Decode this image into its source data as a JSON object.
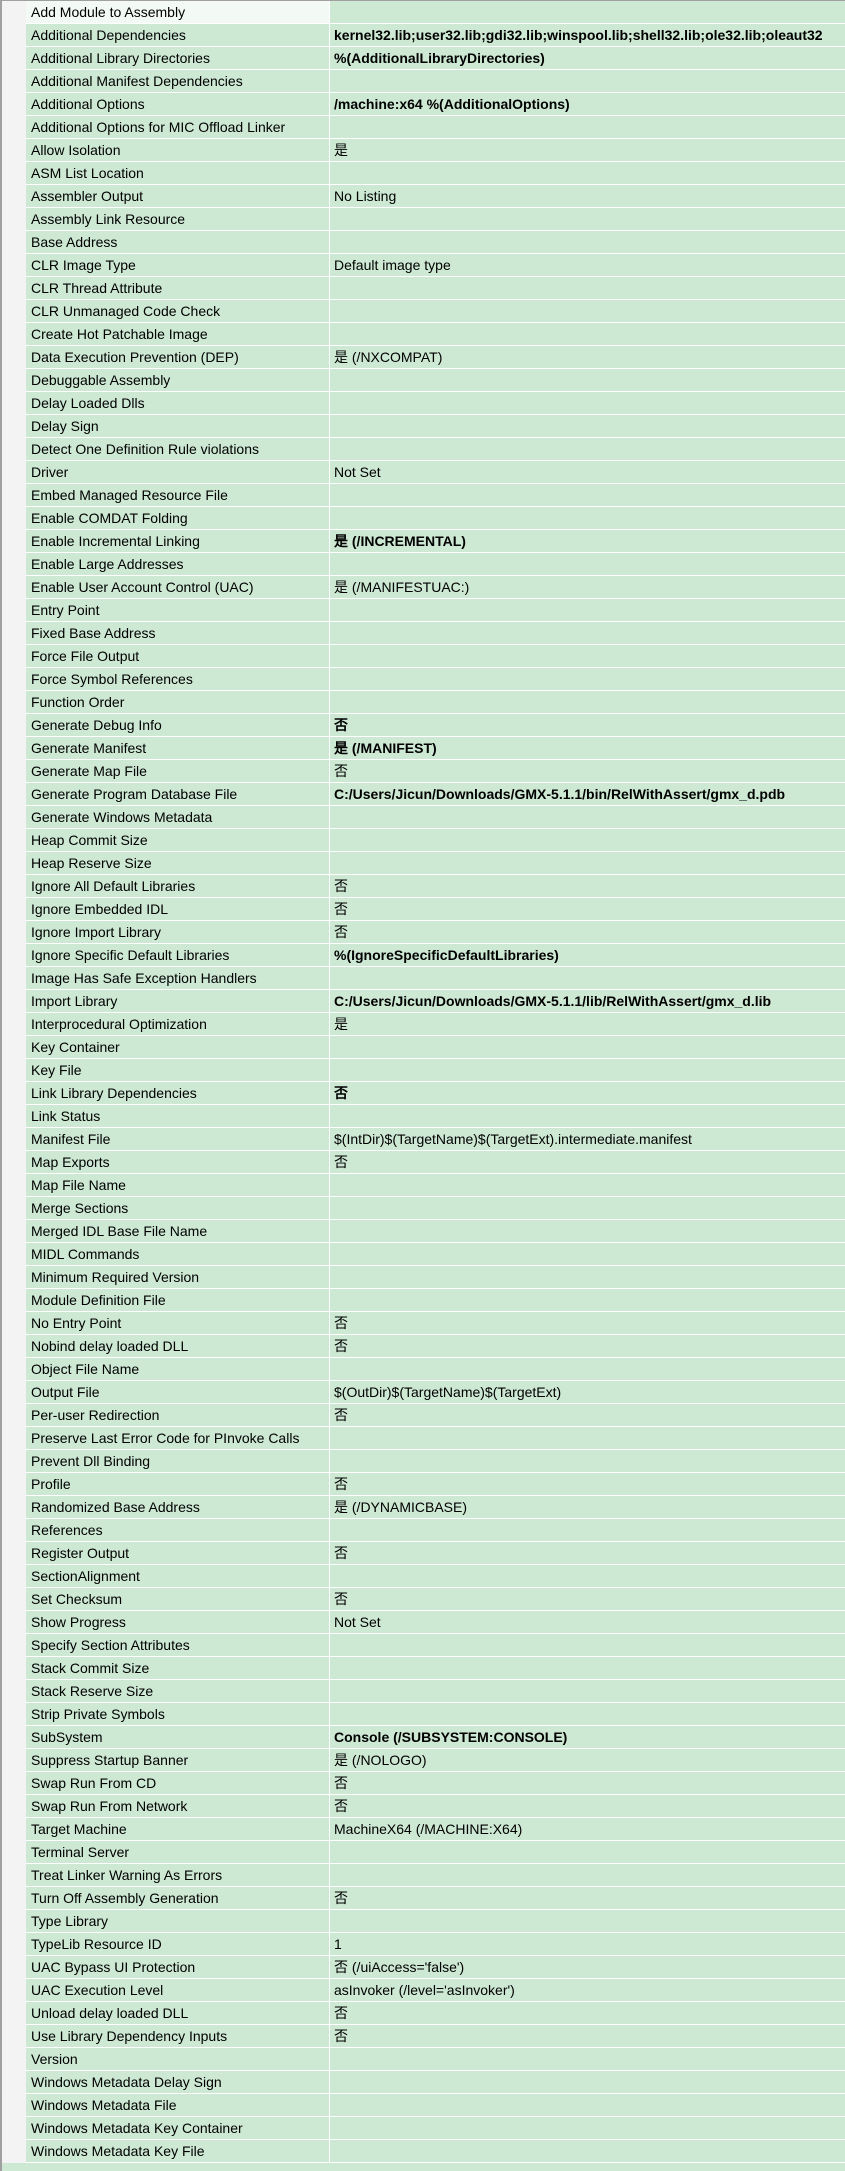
{
  "colors": {
    "row_background": "#cde8d3",
    "separator": "#ffffff"
  },
  "properties": [
    {
      "label": "Add Module to Assembly",
      "value": "",
      "bold": false
    },
    {
      "label": "Additional Dependencies",
      "value": "kernel32.lib;user32.lib;gdi32.lib;winspool.lib;shell32.lib;ole32.lib;oleaut32",
      "bold": true
    },
    {
      "label": "Additional Library Directories",
      "value": "%(AdditionalLibraryDirectories)",
      "bold": true
    },
    {
      "label": "Additional Manifest Dependencies",
      "value": "",
      "bold": false
    },
    {
      "label": "Additional Options",
      "value": " /machine:x64 %(AdditionalOptions)",
      "bold": true
    },
    {
      "label": "Additional Options for MIC Offload Linker",
      "value": "",
      "bold": false
    },
    {
      "label": "Allow Isolation",
      "value": "是",
      "bold": false
    },
    {
      "label": "ASM List Location",
      "value": "",
      "bold": false
    },
    {
      "label": "Assembler Output",
      "value": "No Listing",
      "bold": false
    },
    {
      "label": "Assembly Link Resource",
      "value": "",
      "bold": false
    },
    {
      "label": "Base Address",
      "value": "",
      "bold": false
    },
    {
      "label": "CLR Image Type",
      "value": "Default image type",
      "bold": false
    },
    {
      "label": "CLR Thread Attribute",
      "value": "",
      "bold": false
    },
    {
      "label": "CLR Unmanaged Code Check",
      "value": "",
      "bold": false
    },
    {
      "label": "Create Hot Patchable Image",
      "value": "",
      "bold": false
    },
    {
      "label": "Data Execution Prevention (DEP)",
      "value": "是 (/NXCOMPAT)",
      "bold": false
    },
    {
      "label": "Debuggable Assembly",
      "value": "",
      "bold": false
    },
    {
      "label": "Delay Loaded Dlls",
      "value": "",
      "bold": false
    },
    {
      "label": "Delay Sign",
      "value": "",
      "bold": false
    },
    {
      "label": "Detect One Definition Rule violations",
      "value": "",
      "bold": false
    },
    {
      "label": "Driver",
      "value": "Not Set",
      "bold": false
    },
    {
      "label": "Embed Managed Resource File",
      "value": "",
      "bold": false
    },
    {
      "label": "Enable COMDAT Folding",
      "value": "",
      "bold": false
    },
    {
      "label": "Enable Incremental Linking",
      "value": "是 (/INCREMENTAL)",
      "bold": true
    },
    {
      "label": "Enable Large Addresses",
      "value": "",
      "bold": false
    },
    {
      "label": "Enable User Account Control (UAC)",
      "value": "是 (/MANIFESTUAC:)",
      "bold": false
    },
    {
      "label": "Entry Point",
      "value": "",
      "bold": false
    },
    {
      "label": "Fixed Base Address",
      "value": "",
      "bold": false
    },
    {
      "label": "Force File Output",
      "value": "",
      "bold": false
    },
    {
      "label": "Force Symbol References",
      "value": "",
      "bold": false
    },
    {
      "label": "Function Order",
      "value": "",
      "bold": false
    },
    {
      "label": "Generate Debug Info",
      "value": "否",
      "bold": true
    },
    {
      "label": "Generate Manifest",
      "value": "是 (/MANIFEST)",
      "bold": true
    },
    {
      "label": "Generate Map File",
      "value": "否",
      "bold": false
    },
    {
      "label": "Generate Program Database File",
      "value": "C:/Users/Jicun/Downloads/GMX-5.1.1/bin/RelWithAssert/gmx_d.pdb",
      "bold": true
    },
    {
      "label": "Generate Windows Metadata",
      "value": "",
      "bold": false
    },
    {
      "label": "Heap Commit Size",
      "value": "",
      "bold": false
    },
    {
      "label": "Heap Reserve Size",
      "value": "",
      "bold": false
    },
    {
      "label": "Ignore All Default Libraries",
      "value": "否",
      "bold": false
    },
    {
      "label": "Ignore Embedded IDL",
      "value": "否",
      "bold": false
    },
    {
      "label": "Ignore Import Library",
      "value": "否",
      "bold": false
    },
    {
      "label": "Ignore Specific Default Libraries",
      "value": "%(IgnoreSpecificDefaultLibraries)",
      "bold": true
    },
    {
      "label": "Image Has Safe Exception Handlers",
      "value": "",
      "bold": false
    },
    {
      "label": "Import Library",
      "value": "C:/Users/Jicun/Downloads/GMX-5.1.1/lib/RelWithAssert/gmx_d.lib",
      "bold": true
    },
    {
      "label": "Interprocedural Optimization",
      "value": "是",
      "bold": false
    },
    {
      "label": "Key Container",
      "value": "",
      "bold": false
    },
    {
      "label": "Key File",
      "value": "",
      "bold": false
    },
    {
      "label": "Link Library Dependencies",
      "value": "否",
      "bold": true
    },
    {
      "label": "Link Status",
      "value": "",
      "bold": false
    },
    {
      "label": "Manifest File",
      "value": "$(IntDir)$(TargetName)$(TargetExt).intermediate.manifest",
      "bold": false
    },
    {
      "label": "Map Exports",
      "value": "否",
      "bold": false
    },
    {
      "label": "Map File Name",
      "value": "",
      "bold": false
    },
    {
      "label": "Merge Sections",
      "value": "",
      "bold": false
    },
    {
      "label": "Merged IDL Base File Name",
      "value": "",
      "bold": false
    },
    {
      "label": "MIDL Commands",
      "value": "",
      "bold": false
    },
    {
      "label": "Minimum Required Version",
      "value": "",
      "bold": false
    },
    {
      "label": "Module Definition File",
      "value": "",
      "bold": false
    },
    {
      "label": "No Entry Point",
      "value": "否",
      "bold": false
    },
    {
      "label": "Nobind delay loaded DLL",
      "value": "否",
      "bold": false
    },
    {
      "label": "Object File Name",
      "value": "",
      "bold": false
    },
    {
      "label": "Output File",
      "value": "$(OutDir)$(TargetName)$(TargetExt)",
      "bold": false
    },
    {
      "label": "Per-user Redirection",
      "value": "否",
      "bold": false
    },
    {
      "label": "Preserve Last Error Code for PInvoke Calls",
      "value": "",
      "bold": false
    },
    {
      "label": "Prevent Dll Binding",
      "value": "",
      "bold": false
    },
    {
      "label": "Profile",
      "value": "否",
      "bold": false
    },
    {
      "label": "Randomized Base Address",
      "value": "是 (/DYNAMICBASE)",
      "bold": false
    },
    {
      "label": "References",
      "value": "",
      "bold": false
    },
    {
      "label": "Register Output",
      "value": "否",
      "bold": false
    },
    {
      "label": "SectionAlignment",
      "value": "",
      "bold": false
    },
    {
      "label": "Set Checksum",
      "value": "否",
      "bold": false
    },
    {
      "label": "Show Progress",
      "value": "Not Set",
      "bold": false
    },
    {
      "label": "Specify Section Attributes",
      "value": "",
      "bold": false
    },
    {
      "label": "Stack Commit Size",
      "value": "",
      "bold": false
    },
    {
      "label": "Stack Reserve Size",
      "value": "",
      "bold": false
    },
    {
      "label": "Strip Private Symbols",
      "value": "",
      "bold": false
    },
    {
      "label": "SubSystem",
      "value": "Console (/SUBSYSTEM:CONSOLE)",
      "bold": true
    },
    {
      "label": "Suppress Startup Banner",
      "value": "是 (/NOLOGO)",
      "bold": false
    },
    {
      "label": "Swap Run From CD",
      "value": "否",
      "bold": false
    },
    {
      "label": "Swap Run From Network",
      "value": "否",
      "bold": false
    },
    {
      "label": "Target Machine",
      "value": "MachineX64 (/MACHINE:X64)",
      "bold": false
    },
    {
      "label": "Terminal Server",
      "value": "",
      "bold": false
    },
    {
      "label": "Treat Linker Warning As Errors",
      "value": "",
      "bold": false
    },
    {
      "label": "Turn Off Assembly Generation",
      "value": "否",
      "bold": false
    },
    {
      "label": "Type Library",
      "value": "",
      "bold": false
    },
    {
      "label": "TypeLib Resource ID",
      "value": "1",
      "bold": false
    },
    {
      "label": "UAC Bypass UI Protection",
      "value": "否 (/uiAccess='false')",
      "bold": false
    },
    {
      "label": "UAC Execution Level",
      "value": "asInvoker (/level='asInvoker')",
      "bold": false
    },
    {
      "label": "Unload delay loaded DLL",
      "value": "否",
      "bold": false
    },
    {
      "label": "Use Library Dependency Inputs",
      "value": "否",
      "bold": false
    },
    {
      "label": "Version",
      "value": "",
      "bold": false
    },
    {
      "label": "Windows Metadata Delay Sign",
      "value": "",
      "bold": false
    },
    {
      "label": "Windows Metadata File",
      "value": "",
      "bold": false
    },
    {
      "label": "Windows Metadata Key Container",
      "value": "",
      "bold": false
    },
    {
      "label": "Windows Metadata Key File",
      "value": "",
      "bold": false
    }
  ]
}
